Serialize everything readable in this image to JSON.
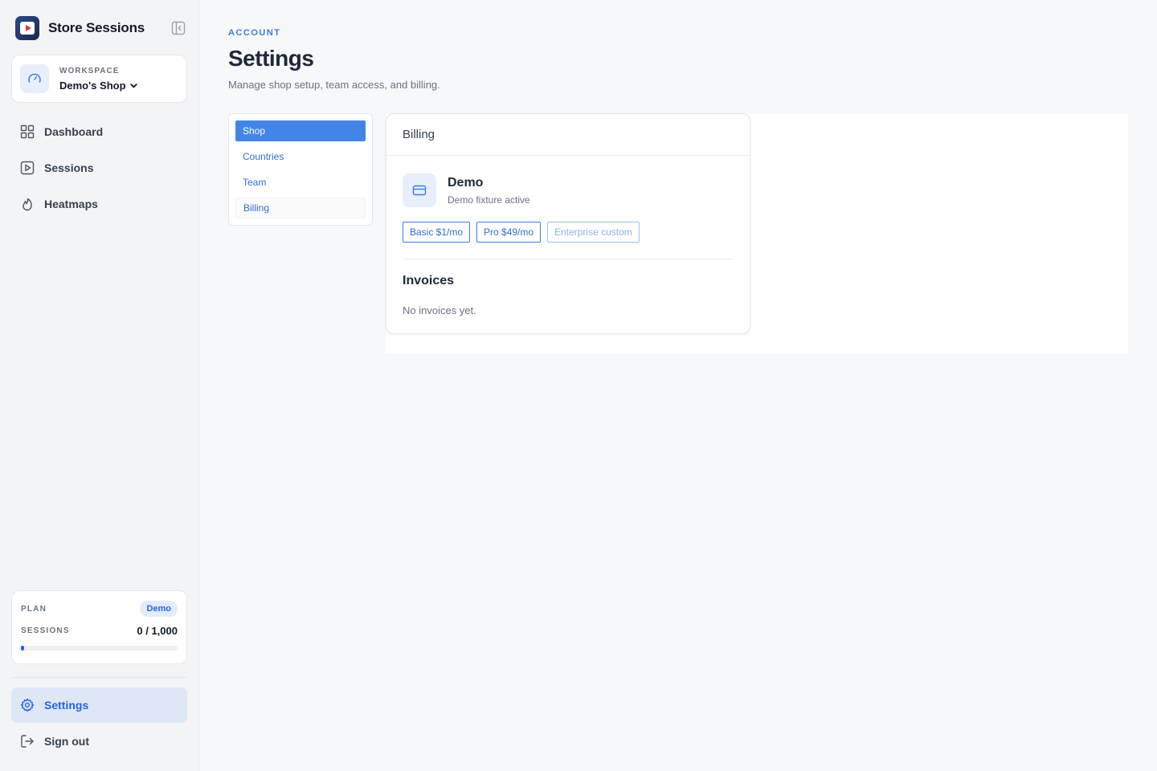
{
  "brand": {
    "name": "Store Sessions"
  },
  "workspace": {
    "label": "WORKSPACE",
    "name": "Demo's Shop"
  },
  "nav": {
    "items": [
      {
        "label": "Dashboard",
        "icon": "grid-icon"
      },
      {
        "label": "Sessions",
        "icon": "play-square-icon"
      },
      {
        "label": "Heatmaps",
        "icon": "flame-icon"
      }
    ]
  },
  "plan": {
    "label": "PLAN",
    "badge": "Demo",
    "sessions_label": "SESSIONS",
    "sessions_count": "0 / 1,000",
    "usage_fraction": 0
  },
  "bottom_nav": {
    "settings": "Settings",
    "signout": "Sign out"
  },
  "page": {
    "eyebrow": "ACCOUNT",
    "title": "Settings",
    "subtitle": "Manage shop setup, team access, and billing."
  },
  "subnav": {
    "items": [
      "Shop",
      "Countries",
      "Team",
      "Billing"
    ],
    "selected": "Shop"
  },
  "billing": {
    "header": "Billing",
    "plan_name": "Demo",
    "plan_status": "Demo fixture active",
    "options": [
      "Basic $1/mo",
      "Pro $49/mo",
      "Enterprise custom"
    ],
    "invoices_title": "Invoices",
    "invoices_empty": "No invoices yet."
  },
  "colors": {
    "accent": "#2563eb",
    "selected_tab": "#4285e6",
    "active_nav_bg": "#dde7f6"
  }
}
